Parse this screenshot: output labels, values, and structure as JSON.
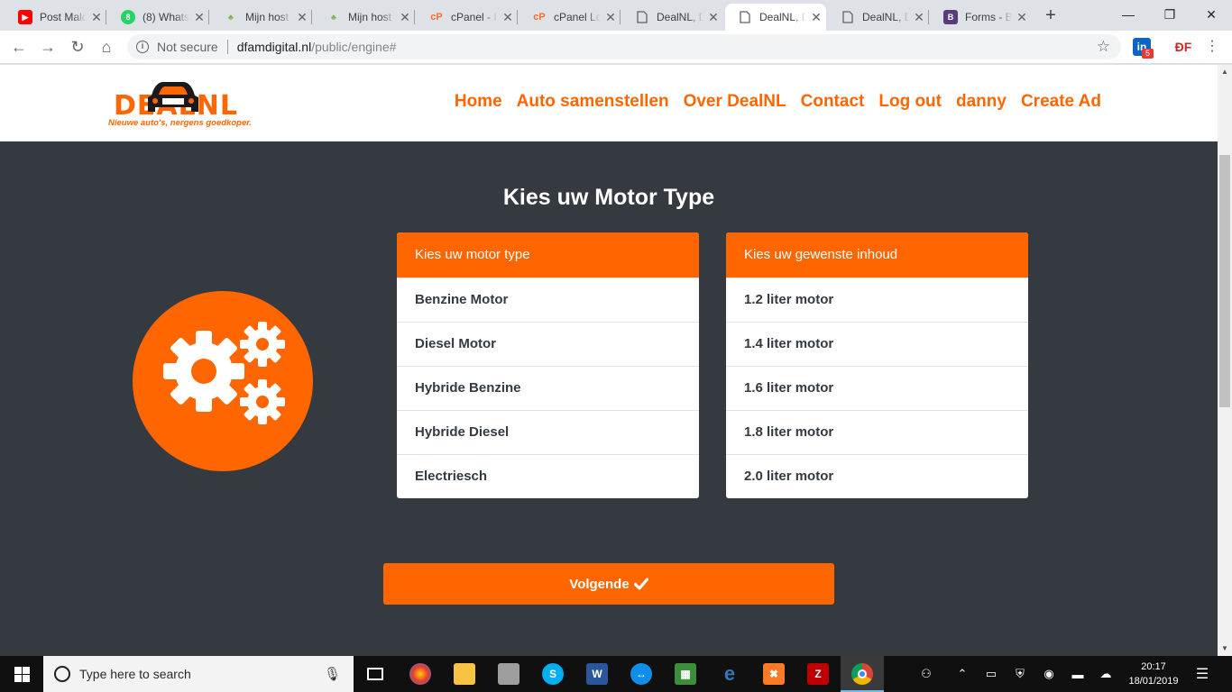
{
  "browser": {
    "tabs": [
      {
        "title": "Post Malc",
        "icon": "youtube-icon",
        "color": "#ff0000"
      },
      {
        "title": "(8) Whats",
        "icon": "whatsapp-icon",
        "color": "#25d366"
      },
      {
        "title": "Mijn host",
        "icon": "hosting-icon",
        "color": "#7cb342"
      },
      {
        "title": "Mijn host",
        "icon": "hosting-icon",
        "color": "#7cb342"
      },
      {
        "title": "cPanel - I",
        "icon": "cpanel-icon",
        "color": "#ff6c2c"
      },
      {
        "title": "cPanel Lo",
        "icon": "cpanel-icon",
        "color": "#ff6c2c"
      },
      {
        "title": "DealNL, D",
        "icon": "page-icon",
        "color": "#5f6368"
      },
      {
        "title": "DealNL, D",
        "icon": "page-icon",
        "color": "#5f6368"
      },
      {
        "title": "DealNL, D",
        "icon": "page-icon",
        "color": "#5f6368"
      },
      {
        "title": "Forms - B",
        "icon": "bootstrap-icon",
        "color": "#563d7c"
      }
    ],
    "active_tab_index": 7,
    "address": {
      "security": "Not secure",
      "host": "dfamdigital.nl",
      "path": "/public/engine#"
    },
    "extension_badge": "5"
  },
  "site": {
    "logo": {
      "word": "DEALNL",
      "tagline": "Nieuwe auto's, nergens goedkoper."
    },
    "nav": [
      "Home",
      "Auto samenstellen",
      "Over DealNL",
      "Contact",
      "Log out",
      "danny",
      "Create Ad"
    ],
    "accent_color": "#ff6600",
    "background_color": "#353940"
  },
  "main": {
    "title": "Kies uw Motor Type",
    "motor_card": {
      "header": "Kies uw motor type",
      "items": [
        "Benzine Motor",
        "Diesel Motor",
        "Hybride Benzine",
        "Hybride Diesel",
        "Electriesch"
      ]
    },
    "content_card": {
      "header": "Kies uw gewenste inhoud",
      "items": [
        "1.2 liter motor",
        "1.4 liter motor",
        "1.6 liter motor",
        "1.8 liter motor",
        "2.0 liter motor"
      ]
    },
    "next_button": "Volgende"
  },
  "taskbar": {
    "search_placeholder": "Type here to search",
    "time": "20:17",
    "date": "18/01/2019"
  }
}
